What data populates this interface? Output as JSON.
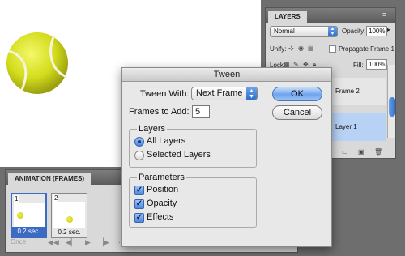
{
  "layers_panel": {
    "tab": "LAYERS",
    "blend_mode": "Normal",
    "opacity_label": "Opacity:",
    "opacity_value": "100%",
    "unify_label": "Unify:",
    "propagate_label": "Propagate Frame 1",
    "lock_label": "Lock:",
    "fill_label": "Fill:",
    "fill_value": "100%",
    "layers": [
      "Frame 2",
      "Layer 1"
    ]
  },
  "animation_panel": {
    "tab": "ANIMATION (FRAMES)",
    "frames": [
      {
        "number": "1",
        "delay": "0.2 sec."
      },
      {
        "number": "2",
        "delay": "0.2 sec."
      }
    ],
    "loop": "Once"
  },
  "dialog": {
    "title": "Tween",
    "tween_with_label": "Tween With:",
    "tween_with_value": "Next Frame",
    "frames_to_add_label": "Frames to Add:",
    "frames_to_add_value": "5",
    "ok_label": "OK",
    "cancel_label": "Cancel",
    "layers_group": "Layers",
    "all_layers": "All Layers",
    "selected_layers": "Selected Layers",
    "parameters_group": "Parameters",
    "position": "Position",
    "opacity": "Opacity",
    "effects": "Effects"
  }
}
